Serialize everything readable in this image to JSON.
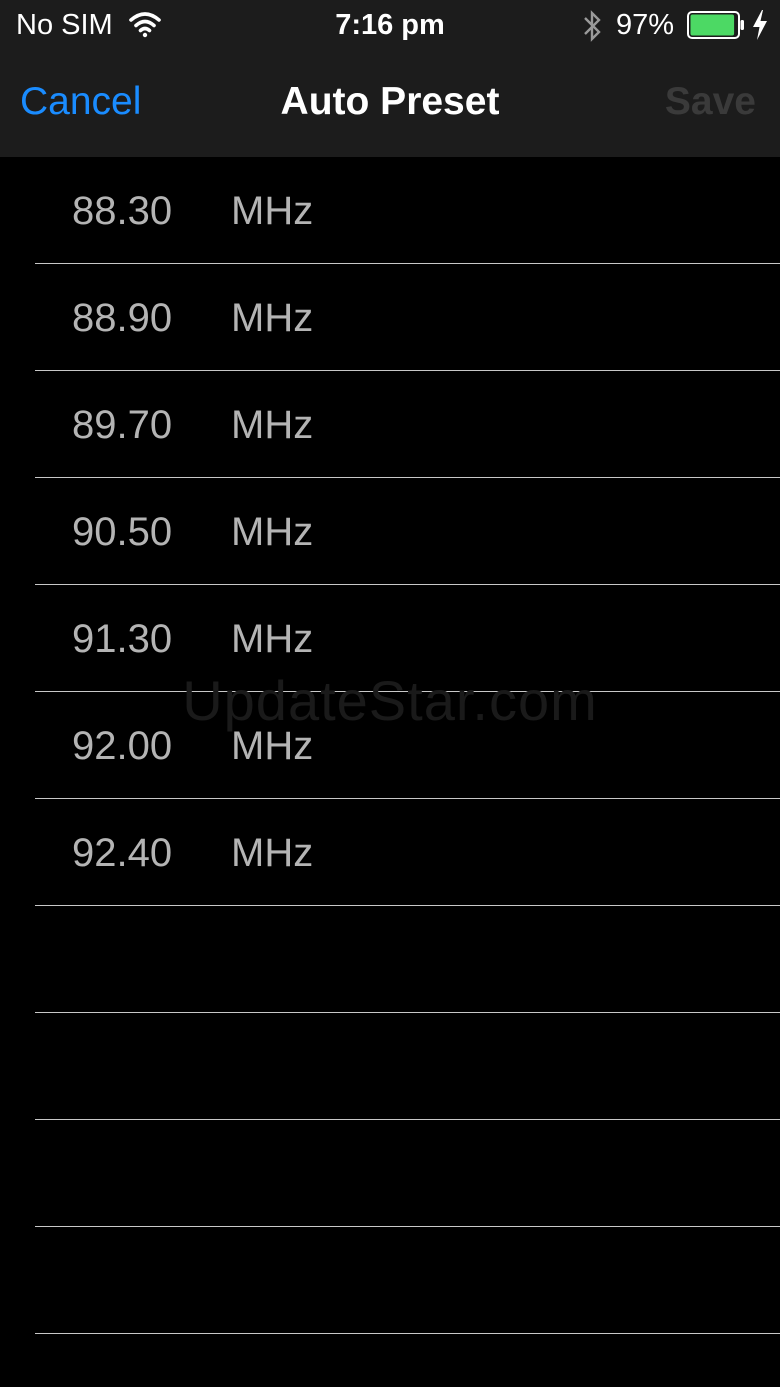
{
  "status_bar": {
    "carrier": "No SIM",
    "time": "7:16 pm",
    "battery_percent": "97%",
    "battery_level": 0.97,
    "battery_color": "#4cd964"
  },
  "nav": {
    "cancel_label": "Cancel",
    "title": "Auto Preset",
    "save_label": "Save",
    "accent_color": "#1a8cff"
  },
  "presets": [
    {
      "frequency": "88.30",
      "unit": "MHz"
    },
    {
      "frequency": "88.90",
      "unit": "MHz"
    },
    {
      "frequency": "89.70",
      "unit": "MHz"
    },
    {
      "frequency": "90.50",
      "unit": "MHz"
    },
    {
      "frequency": "91.30",
      "unit": "MHz"
    },
    {
      "frequency": "92.00",
      "unit": "MHz"
    },
    {
      "frequency": "92.40",
      "unit": "MHz"
    },
    {
      "frequency": "",
      "unit": ""
    },
    {
      "frequency": "",
      "unit": ""
    },
    {
      "frequency": "",
      "unit": ""
    },
    {
      "frequency": "",
      "unit": ""
    }
  ],
  "watermark": "UpdateStar.com",
  "icons": {
    "wifi": "wifi-icon",
    "bluetooth": "bluetooth-icon",
    "battery": "battery-icon",
    "charging": "charging-bolt-icon"
  }
}
